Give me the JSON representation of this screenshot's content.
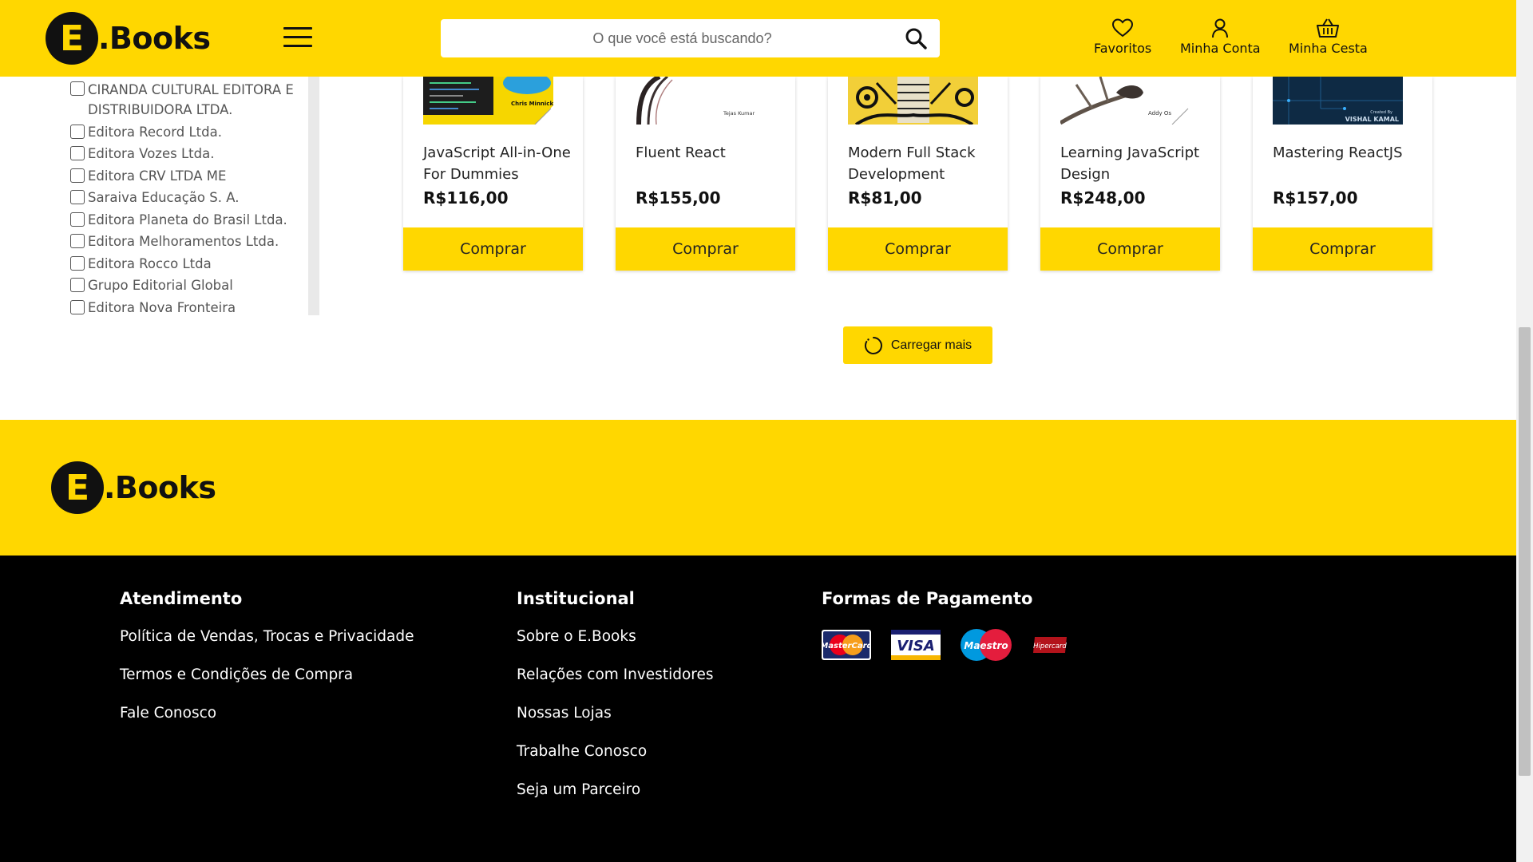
{
  "header": {
    "logo": {
      "letter": "E",
      "word": ".Books"
    },
    "search_placeholder": "O que você está buscando?",
    "favorites_label": "Favoritos",
    "account_label": "Minha Conta",
    "cart_label": "Minha Cesta"
  },
  "filters": {
    "publishers": [
      "CIRANDA CULTURAL EDITORA E DISTRIBUIDORA LTDA.",
      "Editora Record Ltda.",
      "Editora Vozes Ltda.",
      "Editora CRV LTDA ME",
      "Saraiva Educação S. A.",
      "Editora Planeta do Brasil Ltda.",
      "Editora Melhoramentos Ltda.",
      "Editora Rocco Ltda",
      "Grupo Editorial Global",
      "Editora Nova Fronteira"
    ]
  },
  "products": [
    {
      "title": "JavaScript All-in-One For Dummies",
      "price": "R$116,00",
      "buy_label": "Comprar",
      "cover_author": "Chris Minnick"
    },
    {
      "title": "Fluent React",
      "price": "R$155,00",
      "buy_label": "Comprar",
      "cover_author": "Tejas Kumar"
    },
    {
      "title": "Modern Full Stack Development",
      "price": "R$81,00",
      "buy_label": "Comprar"
    },
    {
      "title": "Learning JavaScript Design",
      "price": "R$248,00",
      "buy_label": "Comprar",
      "cover_author": "Addy Os"
    },
    {
      "title": "Mastering ReactJS",
      "price": "R$157,00",
      "buy_label": "Comprar",
      "cover_author": "VISHAL KAMAL",
      "cover_text": "Created By"
    }
  ],
  "load_more_label": "Carregar mais",
  "footer": {
    "logo": {
      "letter": "E",
      "word": ".Books"
    },
    "columns": [
      {
        "title": "Atendimento",
        "links": [
          "Política de Vendas, Trocas e Privacidade",
          "Termos e Condições de Compra",
          "Fale Conosco"
        ]
      },
      {
        "title": "Institucional",
        "links": [
          "Sobre o E.Books",
          "Relações com Investidores",
          "Nossas Lojas",
          "Trabalhe Conosco",
          "Seja um Parceiro"
        ]
      }
    ],
    "payments_title": "Formas de Pagamento",
    "payment_methods": [
      "MasterCard",
      "VISA",
      "Maestro",
      "Hipercard"
    ]
  },
  "colors": {
    "brand_yellow": "#ffd700",
    "footer_black": "#000000"
  },
  "icons": [
    "hamburger-menu-icon",
    "search-icon",
    "heart-icon",
    "user-icon",
    "basket-icon",
    "loading-spinner-icon"
  ]
}
